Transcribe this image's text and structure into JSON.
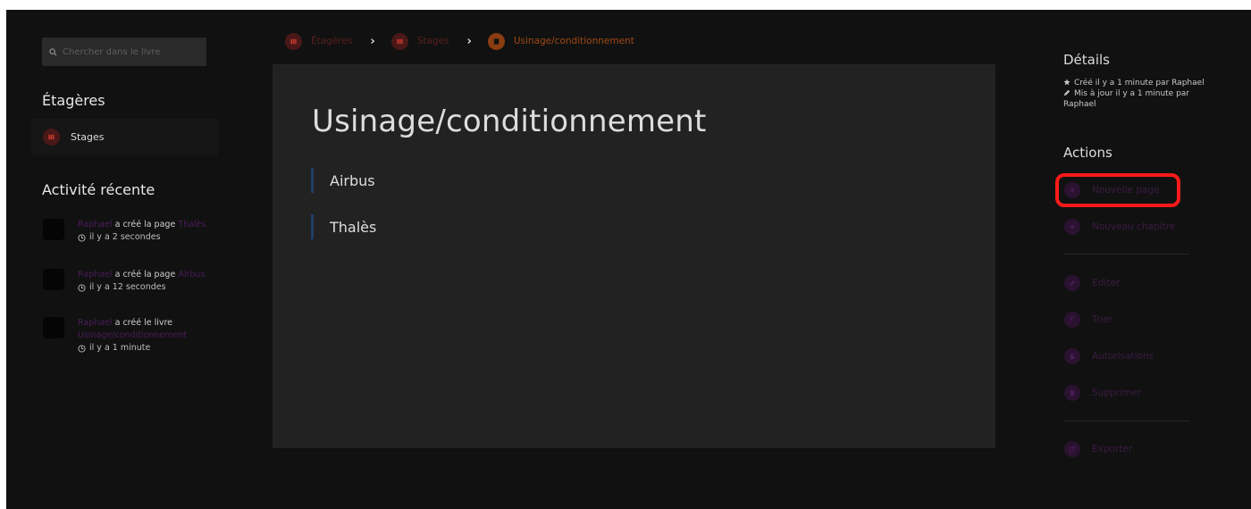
{
  "search": {
    "placeholder": "Chercher dans le livre"
  },
  "sidebar": {
    "shelves_title": "Étagères",
    "shelf_items": [
      {
        "label": "Stages"
      }
    ],
    "activity_title": "Activité récente",
    "activities": [
      {
        "user": "Raphael",
        "action": "a créé la page",
        "target": "Thalès",
        "time": "il y a 2 secondes"
      },
      {
        "user": "Raphael",
        "action": "a créé la page",
        "target": "Airbus",
        "time": "il y a 12 secondes"
      },
      {
        "user": "Raphael",
        "action": "a créé le livre",
        "target": "Usinage/conditionnement",
        "time": "il y a 1 minute"
      }
    ]
  },
  "breadcrumb": [
    {
      "label": "Étagères",
      "color": "#5a1f1f"
    },
    {
      "label": "Stages",
      "color": "#5a1f1f"
    },
    {
      "label": "Usinage/conditionnement",
      "color": "#a04a14"
    }
  ],
  "book": {
    "title": "Usinage/conditionnement",
    "chapters": [
      {
        "label": "Airbus"
      },
      {
        "label": "Thalès"
      }
    ]
  },
  "details": {
    "title": "Détails",
    "created": "Créé il y a 1 minute par Raphael",
    "updated": "Mis à jour il y a 1 minute par Raphael"
  },
  "actions": {
    "title": "Actions",
    "items": [
      {
        "label": "Nouvelle page",
        "icon": "plus-icon"
      },
      {
        "label": "Nouveau chapitre",
        "icon": "plus-icon"
      },
      {
        "label": "Editer",
        "icon": "pencil-icon"
      },
      {
        "label": "Trier",
        "icon": "sort-icon"
      },
      {
        "label": "Autorisations",
        "icon": "lock-icon"
      },
      {
        "label": "Supprimer",
        "icon": "trash-icon"
      },
      {
        "label": "Exporter",
        "icon": "export-icon"
      }
    ]
  },
  "colors": {
    "background": "#111111",
    "card": "#222222",
    "link_purple": "#4a1d56",
    "shelf_red": "#5a1f1f",
    "book_orange": "#a04a14",
    "highlight_red": "#ff1a1a"
  }
}
